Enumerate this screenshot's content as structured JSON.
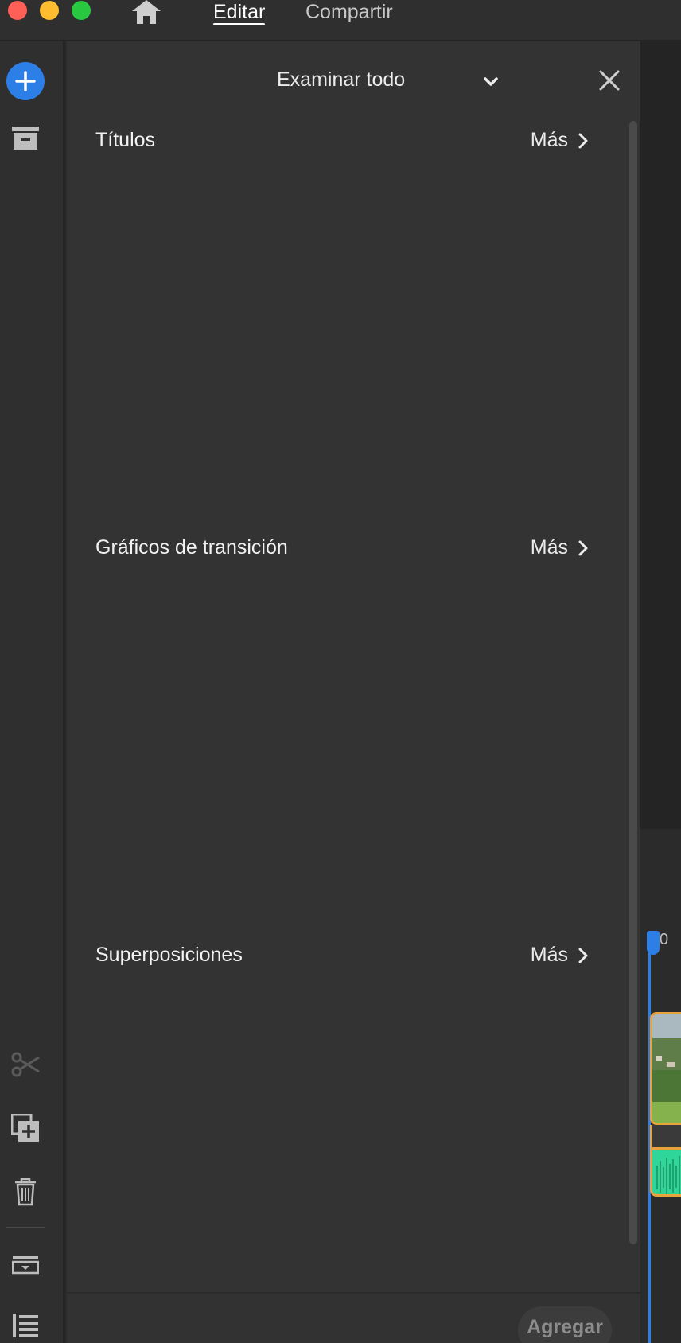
{
  "topbar": {
    "tabs": [
      {
        "label": "Editar",
        "active": true
      },
      {
        "label": "Compartir",
        "active": false
      }
    ]
  },
  "panel": {
    "title": "Examinar todo",
    "sections": [
      {
        "title": "Títulos",
        "more": "Más"
      },
      {
        "title": "Gráficos de transición",
        "more": "Más"
      },
      {
        "title": "Superposiciones",
        "more": "Más"
      }
    ],
    "add_button": "Agregar"
  },
  "timeline": {
    "playhead_label": "0"
  },
  "colors": {
    "accent": "#2d7fe8",
    "clip_border": "#e8a33a",
    "audio": "#2fd69a",
    "panel": "#333333"
  },
  "icons": {
    "rail": [
      "add-circle-icon",
      "archive-icon",
      "scissors-icon",
      "duplicate-add-icon",
      "trash-icon",
      "tray-icon",
      "list-icon"
    ]
  }
}
